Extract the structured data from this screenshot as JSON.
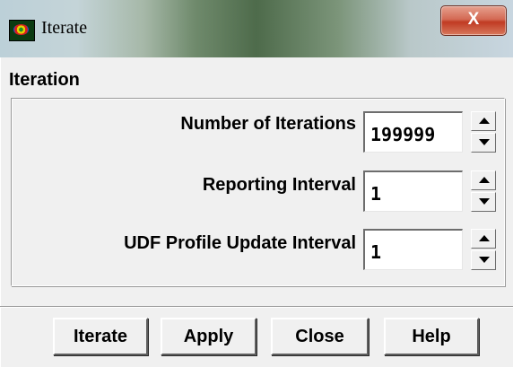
{
  "window": {
    "title": "Iterate",
    "close_glyph": "X"
  },
  "group": {
    "title": "Iteration"
  },
  "fields": [
    {
      "label": "Number of Iterations",
      "value": "199999"
    },
    {
      "label": "Reporting Interval",
      "value": "1"
    },
    {
      "label": "UDF Profile Update Interval",
      "value": "1"
    }
  ],
  "buttons": {
    "iterate": "Iterate",
    "apply": "Apply",
    "close": "Close",
    "help": "Help"
  },
  "icons": {
    "app": "fluent-app-icon",
    "spin_up": "arrow-up-icon",
    "spin_down": "arrow-down-icon",
    "close": "close-icon"
  },
  "colors": {
    "close_button": "#c03a22",
    "dialog_bg": "#f0f0f0"
  }
}
